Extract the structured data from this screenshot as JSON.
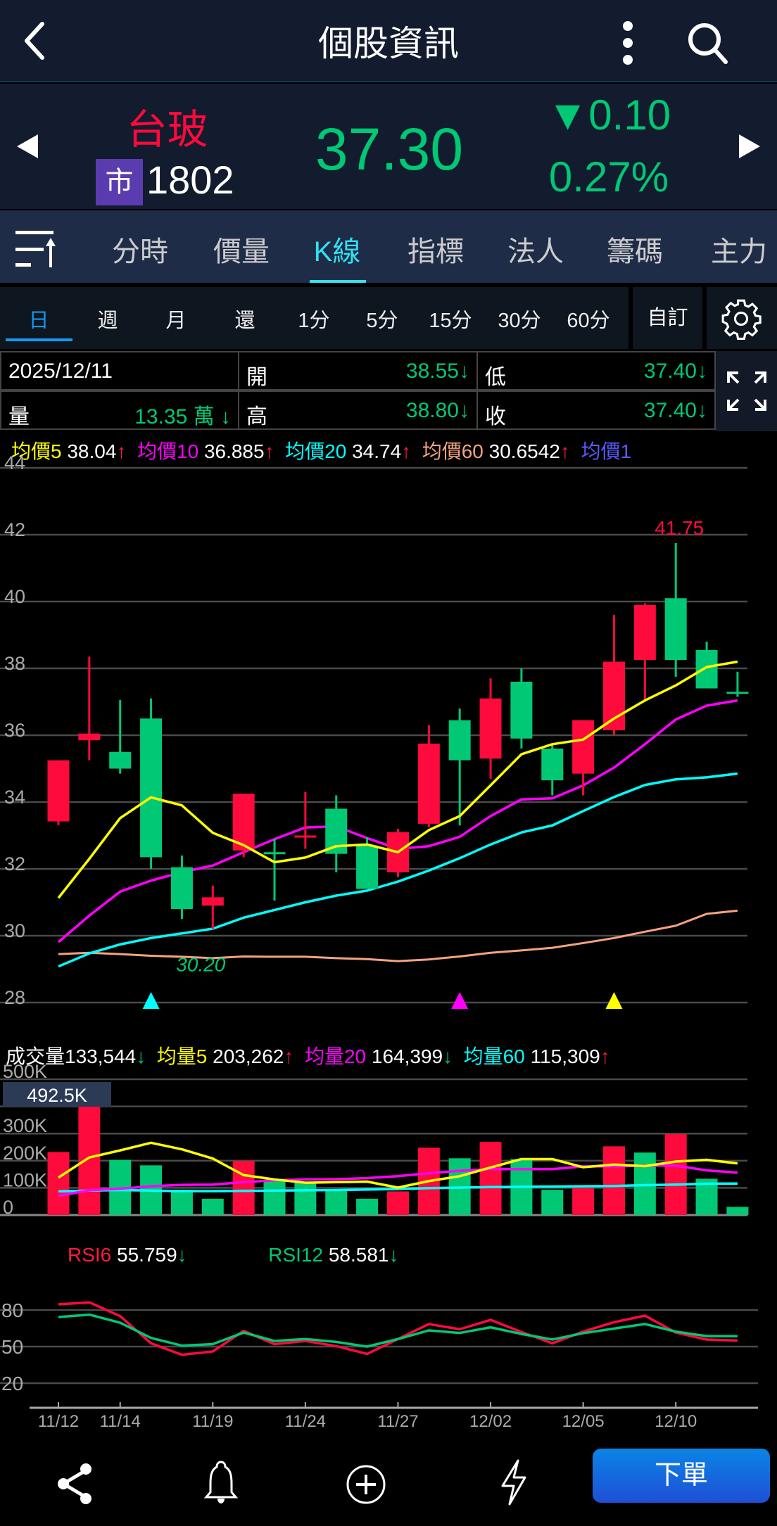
{
  "nav": {
    "title": "個股資訊"
  },
  "quote": {
    "name": "台玻",
    "market_badge": "市",
    "code": "1802",
    "price": "37.30",
    "change": "▼0.10",
    "change_pct": "0.27%"
  },
  "tabs": [
    {
      "label": "分時"
    },
    {
      "label": "價量"
    },
    {
      "label": "K線",
      "active": true
    },
    {
      "label": "指標"
    },
    {
      "label": "法人"
    },
    {
      "label": "籌碼"
    },
    {
      "label": "主力"
    }
  ],
  "periods": [
    {
      "label": "日",
      "active": true
    },
    {
      "label": "週"
    },
    {
      "label": "月"
    },
    {
      "label": "還"
    },
    {
      "label": "1分"
    },
    {
      "label": "5分"
    },
    {
      "label": "15分"
    },
    {
      "label": "30分"
    },
    {
      "label": "60分"
    }
  ],
  "custom_label": "自訂",
  "info": {
    "date": "2025/12/11",
    "open_label": "開",
    "open": "38.55↓",
    "low_label": "低",
    "low": "37.40↓",
    "volume_label": "量",
    "volume": "13.35 萬 ↓",
    "high_label": "高",
    "high": "38.80↓",
    "close_label": "收",
    "close": "37.40↓"
  },
  "ma_legend": [
    {
      "label": "均價5",
      "value": "38.04",
      "arrow": "↑",
      "color": "#ffff00"
    },
    {
      "label": "均價10",
      "value": "36.885",
      "arrow": "↑",
      "color": "#ff00ff"
    },
    {
      "label": "均價20",
      "value": "34.74",
      "arrow": "↑",
      "color": "#00ffff"
    },
    {
      "label": "均價60",
      "value": "30.6542",
      "arrow": "↑",
      "color": "#f5a37f"
    },
    {
      "label": "均價1",
      "value": "",
      "arrow": "",
      "color": "#5a5aff"
    }
  ],
  "vol_legend": [
    {
      "label": "成交量",
      "value": "133,544",
      "arrow": "↓",
      "color": "#ffffff",
      "arrow_color": "#00c875"
    },
    {
      "label": "均量5",
      "value": "203,262",
      "arrow": "↑",
      "color": "#ffff00",
      "arrow_color": "#ff1a40"
    },
    {
      "label": "均量20",
      "value": "164,399",
      "arrow": "↓",
      "color": "#ff00ff",
      "arrow_color": "#00c875"
    },
    {
      "label": "均量60",
      "value": "115,309",
      "arrow": "↑",
      "color": "#00ffff",
      "arrow_color": "#ff1a40"
    }
  ],
  "rsi_legend": [
    {
      "label": "RSI6",
      "value": "55.759",
      "arrow": "↓",
      "color": "#ff1a40"
    },
    {
      "label": "RSI12",
      "value": "58.581",
      "arrow": "↓",
      "color": "#00c875"
    }
  ],
  "order_button": "下單",
  "colors": {
    "up": "#ff0a3c",
    "down": "#00c875",
    "ma5": "#ffff00",
    "ma10": "#ff00ff",
    "ma20": "#00ffff",
    "ma60": "#f5a37f"
  },
  "chart_data": [
    {
      "type": "candlestick",
      "title": "K線",
      "ylim": [
        28,
        44
      ],
      "yticks": [
        44,
        42,
        40,
        38,
        36,
        34,
        32,
        30,
        28
      ],
      "candles": [
        {
          "o": 33.42,
          "h": 35.25,
          "l": 33.31,
          "c": 35.25,
          "dir": "up"
        },
        {
          "o": 35.85,
          "h": 38.35,
          "l": 35.25,
          "c": 36.05,
          "dir": "up"
        },
        {
          "o": 35.5,
          "h": 37.05,
          "l": 34.85,
          "c": 35.0,
          "dir": "down"
        },
        {
          "o": 36.5,
          "h": 37.1,
          "l": 32.0,
          "c": 32.35,
          "dir": "down"
        },
        {
          "o": 32.05,
          "h": 32.4,
          "l": 30.5,
          "c": 30.8,
          "dir": "down"
        },
        {
          "o": 30.9,
          "h": 31.5,
          "l": 30.2,
          "c": 31.15,
          "dir": "up"
        },
        {
          "o": 32.55,
          "h": 34.25,
          "l": 32.35,
          "c": 34.25,
          "dir": "up"
        },
        {
          "o": 32.5,
          "h": 32.9,
          "l": 31.05,
          "c": 32.45,
          "dir": "down"
        },
        {
          "o": 32.95,
          "h": 34.3,
          "l": 32.6,
          "c": 33.0,
          "dir": "up"
        },
        {
          "o": 33.8,
          "h": 34.2,
          "l": 31.9,
          "c": 32.45,
          "dir": "down"
        },
        {
          "o": 32.7,
          "h": 32.95,
          "l": 31.4,
          "c": 31.4,
          "dir": "down"
        },
        {
          "o": 31.9,
          "h": 33.2,
          "l": 31.75,
          "c": 33.1,
          "dir": "up"
        },
        {
          "o": 33.35,
          "h": 36.3,
          "l": 33.25,
          "c": 35.75,
          "dir": "up"
        },
        {
          "o": 36.45,
          "h": 36.8,
          "l": 33.3,
          "c": 35.25,
          "dir": "down"
        },
        {
          "o": 35.3,
          "h": 37.7,
          "l": 34.7,
          "c": 37.1,
          "dir": "up"
        },
        {
          "o": 37.6,
          "h": 38.0,
          "l": 35.6,
          "c": 35.9,
          "dir": "down"
        },
        {
          "o": 35.6,
          "h": 35.7,
          "l": 34.2,
          "c": 34.65,
          "dir": "down"
        },
        {
          "o": 34.85,
          "h": 36.45,
          "l": 34.2,
          "c": 36.45,
          "dir": "up"
        },
        {
          "o": 36.15,
          "h": 39.6,
          "l": 36.0,
          "c": 38.2,
          "dir": "up"
        },
        {
          "o": 38.25,
          "h": 39.95,
          "l": 37.0,
          "c": 39.9,
          "dir": "up"
        },
        {
          "o": 40.1,
          "h": 41.75,
          "l": 37.75,
          "c": 38.25,
          "dir": "down"
        },
        {
          "o": 38.55,
          "h": 38.8,
          "l": 37.4,
          "c": 37.4,
          "dir": "down"
        },
        {
          "o": 37.3,
          "h": 37.9,
          "l": 37.15,
          "c": 37.3,
          "dir": "down"
        }
      ],
      "ma5": [
        31.13,
        32.3,
        33.52,
        34.14,
        33.9,
        33.08,
        32.71,
        32.2,
        32.34,
        32.68,
        32.73,
        32.5,
        33.16,
        33.58,
        34.5,
        35.43,
        35.73,
        35.87,
        36.5,
        37.04,
        37.49,
        38.04,
        38.2
      ],
      "ma10": [
        29.81,
        30.6,
        31.32,
        31.65,
        31.9,
        32.1,
        32.5,
        32.89,
        33.24,
        33.27,
        32.92,
        32.6,
        32.68,
        32.96,
        33.58,
        34.08,
        34.11,
        34.5,
        35.03,
        35.73,
        36.47,
        36.885,
        37.04
      ],
      "ma20": [
        29.08,
        29.47,
        29.74,
        29.93,
        30.07,
        30.21,
        30.54,
        30.77,
        31.0,
        31.2,
        31.35,
        31.62,
        31.95,
        32.32,
        32.73,
        33.09,
        33.3,
        33.73,
        34.15,
        34.51,
        34.68,
        34.74,
        34.85
      ],
      "ma60": [
        29.45,
        29.49,
        29.45,
        29.4,
        29.37,
        29.33,
        29.38,
        29.37,
        29.37,
        29.33,
        29.3,
        29.24,
        29.29,
        29.38,
        29.49,
        29.56,
        29.64,
        29.78,
        29.93,
        30.12,
        30.3,
        30.6542,
        30.75
      ],
      "annotations": [
        {
          "index": 20,
          "value": 41.75,
          "text": "41.75",
          "kind": "high"
        },
        {
          "index": 5,
          "value": 30.2,
          "text": "30.20",
          "kind": "low"
        }
      ],
      "markers": [
        {
          "index": 3,
          "color": "#00ffff"
        },
        {
          "index": 13,
          "color": "#ff00ff"
        },
        {
          "index": 18,
          "color": "#ffff00"
        }
      ]
    },
    {
      "type": "bar",
      "title": "成交量",
      "unit": "K",
      "ylim": [
        0,
        500
      ],
      "yticks": [
        {
          "v": 500,
          "t": "500K"
        },
        {
          "v": 300,
          "t": "300K"
        },
        {
          "v": 200,
          "t": "200K"
        },
        {
          "v": 100,
          "t": "100K"
        },
        {
          "v": 0,
          "t": "0"
        }
      ],
      "gridlines": [
        500,
        400,
        300,
        200,
        100,
        0
      ],
      "max_label": "492.5K",
      "values": [
        232,
        492.5,
        203,
        183,
        93,
        60,
        199,
        125,
        121,
        93,
        60,
        87,
        248,
        209,
        269,
        206,
        93,
        100,
        253,
        230,
        298,
        133.544,
        30
      ],
      "dirs": [
        "up",
        "up",
        "down",
        "down",
        "down",
        "down",
        "up",
        "down",
        "down",
        "down",
        "down",
        "up",
        "up",
        "down",
        "up",
        "down",
        "down",
        "up",
        "up",
        "down",
        "up",
        "down",
        "down"
      ],
      "vma5": [
        138,
        212,
        238,
        266,
        242,
        208,
        147,
        131,
        119,
        121,
        123,
        101,
        125,
        143,
        175,
        206,
        206,
        176,
        186,
        180,
        197,
        203.262,
        190
      ],
      "vma20": [
        71,
        91,
        97,
        106,
        111,
        112,
        121,
        128,
        131,
        132,
        136,
        143,
        154,
        163,
        169,
        169,
        169,
        179,
        179,
        182,
        182,
        164.399,
        156
      ],
      "vma60": [
        87,
        90,
        92,
        90,
        88,
        88,
        89,
        90,
        91,
        92,
        94,
        96,
        99,
        101,
        103,
        104,
        105,
        106,
        107,
        110,
        112,
        115.309,
        116
      ]
    },
    {
      "type": "line",
      "title": "RSI",
      "ylim": [
        0,
        100
      ],
      "yticks": [
        80,
        50,
        20
      ],
      "series": [
        {
          "name": "RSI6",
          "color": "#ff0a3c",
          "values": [
            84.6,
            86.3,
            75,
            52.7,
            43.3,
            46,
            62.9,
            52,
            54.6,
            50.4,
            44,
            56.2,
            68.5,
            64.2,
            71.9,
            62,
            52.7,
            62.3,
            70,
            75.4,
            61.5,
            55.759,
            55
          ]
        },
        {
          "name": "RSI12",
          "color": "#00c875",
          "values": [
            74.2,
            76.2,
            69.6,
            57.1,
            50.8,
            52,
            61.5,
            54.6,
            56.2,
            53.8,
            50,
            56.2,
            63.3,
            61.2,
            65.8,
            60.4,
            55.8,
            61,
            64.8,
            68.5,
            62.3,
            58.581,
            58.5
          ]
        }
      ],
      "xticks": [
        {
          "index": 0,
          "label": "11/12"
        },
        {
          "index": 2,
          "label": "11/14"
        },
        {
          "index": 5,
          "label": "11/19"
        },
        {
          "index": 8,
          "label": "11/24"
        },
        {
          "index": 11,
          "label": "11/27"
        },
        {
          "index": 14,
          "label": "12/02"
        },
        {
          "index": 17,
          "label": "12/05"
        },
        {
          "index": 20,
          "label": "12/10"
        }
      ]
    }
  ]
}
